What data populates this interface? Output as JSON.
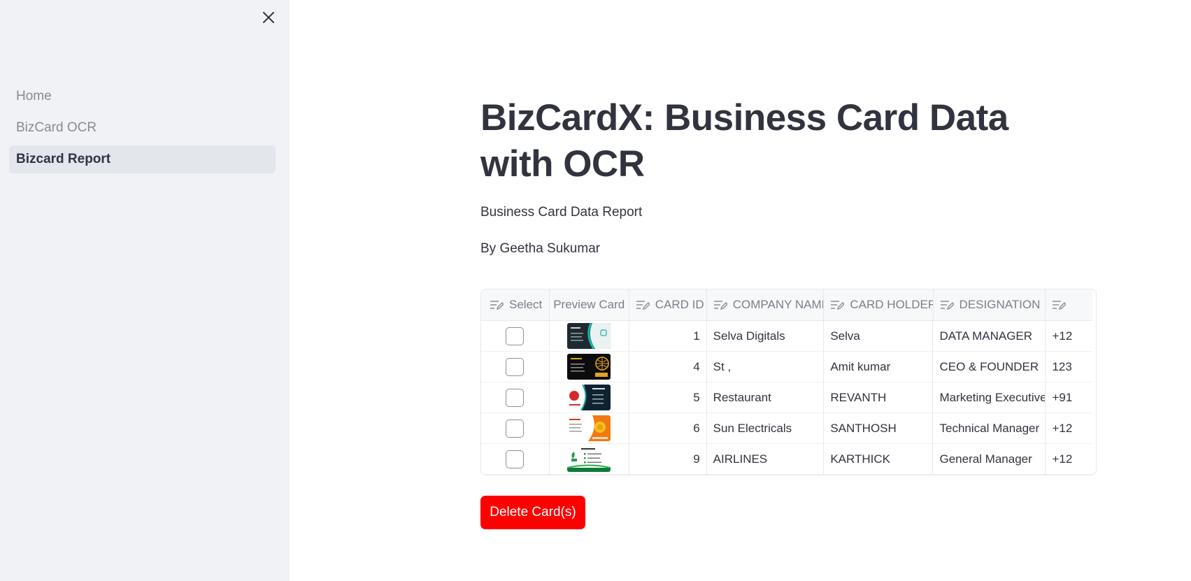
{
  "sidebar": {
    "close_icon": "close-icon",
    "items": [
      {
        "label": "Home",
        "active": false
      },
      {
        "label": "BizCard OCR",
        "active": false
      },
      {
        "label": "Bizcard Report",
        "active": true
      }
    ]
  },
  "main": {
    "title": "BizCardX: Business Card Data with OCR",
    "subtitle": "Business Card Data Report",
    "author": "By Geetha Sukumar"
  },
  "table": {
    "columns": [
      "Select",
      "Preview Card",
      "CARD ID",
      "COMPANY NAME",
      "CARD HOLDER",
      "DESIGNATION",
      ""
    ],
    "rows": [
      {
        "card_id": "1",
        "company": "Selva Digitals",
        "holder": "Selva",
        "designation": "DATA MANAGER",
        "phone": "+12",
        "thumb": "dark-teal"
      },
      {
        "card_id": "4",
        "company": "St ,",
        "holder": "Amit kumar",
        "designation": "CEO & FOUNDER",
        "phone": "123",
        "thumb": "black-gold"
      },
      {
        "card_id": "5",
        "company": "Restaurant",
        "holder": "REVANTH",
        "designation": "Marketing Executive",
        "phone": "+91",
        "thumb": "red-navy"
      },
      {
        "card_id": "6",
        "company": "Sun Electricals",
        "holder": "SANTHOSH",
        "designation": "Technical Manager",
        "phone": "+12",
        "thumb": "white-orange"
      },
      {
        "card_id": "9",
        "company": "AIRLINES",
        "holder": "KARTHICK",
        "designation": "General Manager",
        "phone": "+12",
        "thumb": "white-green"
      }
    ]
  },
  "actions": {
    "delete_label": "Delete Card(s)"
  },
  "colors": {
    "sidebar_bg": "#f0f2f6",
    "text": "#31333f",
    "delete_button": "#ff0000"
  }
}
